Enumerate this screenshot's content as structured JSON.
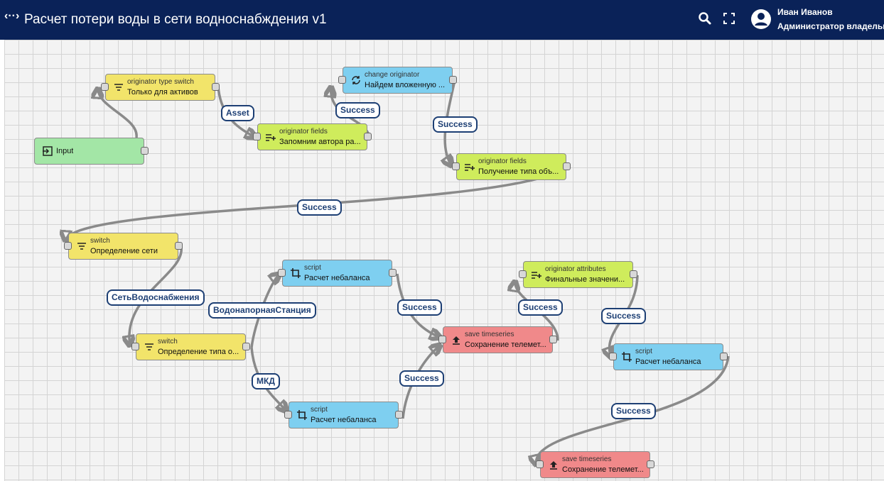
{
  "header": {
    "back_glyph": "‹··›",
    "title": "Расчет потери воды в сети водноснабждения v1",
    "user_name": "Иван Иванов",
    "user_role": "Администратор владельца",
    "icons": [
      "search-icon",
      "fullscreen-icon",
      "account-circle-icon"
    ]
  },
  "nodes": [
    {
      "id": "input",
      "label": "Input",
      "icon": "input-icon",
      "color": "#a3e6a6"
    },
    {
      "id": "n1",
      "type": "originator type switch",
      "name": "Только для активов",
      "icon": "filter-icon",
      "color": "#f2e46a"
    },
    {
      "id": "n2",
      "type": "change originator",
      "name": "Найдем вложенную ...",
      "icon": "change-originator-icon",
      "color": "#7ecff0"
    },
    {
      "id": "n3",
      "type": "originator fields",
      "name": "Запомним автора ра...",
      "icon": "enrichment-icon",
      "color": "#cfec5c"
    },
    {
      "id": "n4",
      "type": "originator fields",
      "name": "Получение типа объ...",
      "icon": "enrichment-icon",
      "color": "#cfec5c"
    },
    {
      "id": "n5",
      "type": "switch",
      "name": "Определение сети",
      "icon": "filter-icon",
      "color": "#f2e46a"
    },
    {
      "id": "n6",
      "type": "script",
      "name": "Расчет небаланса",
      "icon": "transform-icon",
      "color": "#7ecff0"
    },
    {
      "id": "n7",
      "type": "originator attributes",
      "name": "Финальные значени...",
      "icon": "enrichment-icon",
      "color": "#cfec5c"
    },
    {
      "id": "n8",
      "type": "save timeseries",
      "name": "Сохранение телемет...",
      "icon": "upload-icon",
      "color": "#f0898a"
    },
    {
      "id": "n9",
      "type": "switch",
      "name": "Определение типа о...",
      "icon": "filter-icon",
      "color": "#f2e46a"
    },
    {
      "id": "n10",
      "type": "script",
      "name": "Расчет небаланса",
      "icon": "transform-icon",
      "color": "#7ecff0"
    },
    {
      "id": "n11",
      "type": "script",
      "name": "Расчет небаланса",
      "icon": "transform-icon",
      "color": "#7ecff0"
    },
    {
      "id": "n12",
      "type": "save timeseries",
      "name": "Сохранение телемет...",
      "icon": "upload-icon",
      "color": "#f0898a"
    }
  ],
  "edges": [
    {
      "from": "n1",
      "to": "n3",
      "label": "Asset"
    },
    {
      "from": "n3",
      "to": "n2",
      "label": "Success"
    },
    {
      "from": "n2",
      "to": "n4",
      "label": "Success"
    },
    {
      "from": "n4",
      "to": "n5",
      "label": "Success"
    },
    {
      "from": "n5",
      "to": "n9",
      "label": "СетьВодоснабжения"
    },
    {
      "from": "n9",
      "to": "n6",
      "label": "ВодонапорнаяСтанция"
    },
    {
      "from": "n9",
      "to": "n10",
      "label": "МКД"
    },
    {
      "from": "n6",
      "to": "n8",
      "label": "Success"
    },
    {
      "from": "n10",
      "to": "n8",
      "label": "Success"
    },
    {
      "from": "n8",
      "to": "n7",
      "label": "Success"
    },
    {
      "from": "n7",
      "to": "n11",
      "label": "Success"
    },
    {
      "from": "n11",
      "to": "n12",
      "label": "Success"
    }
  ]
}
